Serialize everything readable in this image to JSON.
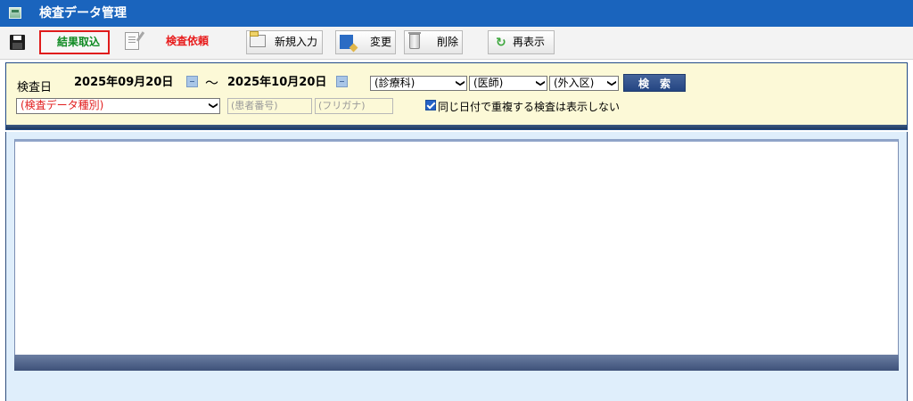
{
  "window": {
    "title": "検査データ管理",
    "icon": "app-icon"
  },
  "toolbar": {
    "save_icon": "floppy-disk-icon",
    "result_import": "結果取込",
    "test_request": "検査依頼",
    "new_entry": "新規入力",
    "edit": "変更",
    "delete": "削除",
    "refresh": "再表示",
    "colors": {
      "result_import": "#0f8a22",
      "test_request": "#e81c1c",
      "highlight_border": "#e01c1c"
    }
  },
  "search": {
    "date_label": "検査日",
    "date_from": "2025年09月20日",
    "date_to": "2025年10月20日",
    "tilde": "～",
    "department": "(診療科)",
    "doctor": "(医師)",
    "inpatient_outpatient": "(外入区)",
    "search_button": "検　索",
    "data_type": "(検査データ種別)",
    "patient_number_placeholder": "(患者番号)",
    "furigana_placeholder": "(フリガナ)",
    "hide_duplicates_checked": true,
    "hide_duplicates_label": "同じ日付で重複する検査は表示しない"
  },
  "results": {
    "rows": []
  }
}
